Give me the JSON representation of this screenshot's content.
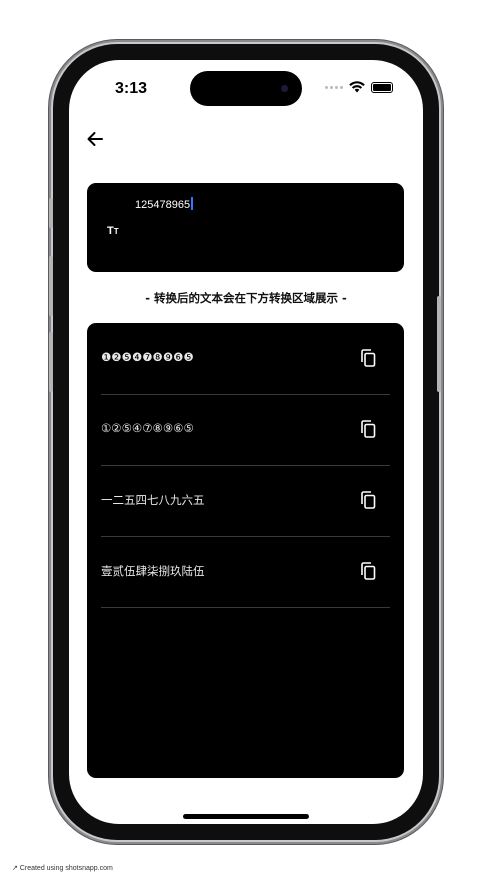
{
  "status_bar": {
    "time": "3:13"
  },
  "input": {
    "value": "125478965",
    "format_icon_big": "T",
    "format_icon_small": "T"
  },
  "hint": "-  转换后的文本会在下方转换区域展示  -",
  "results": [
    {
      "text": "❶❷❺❹❼❽❾❻❺"
    },
    {
      "text": "①②⑤④⑦⑧⑨⑥⑤"
    },
    {
      "text": "一二五四七八九六五"
    },
    {
      "text": "壹贰伍肆柒捌玖陆伍"
    }
  ],
  "footer": {
    "credit": "↗ Created using shotsnapp.com"
  }
}
